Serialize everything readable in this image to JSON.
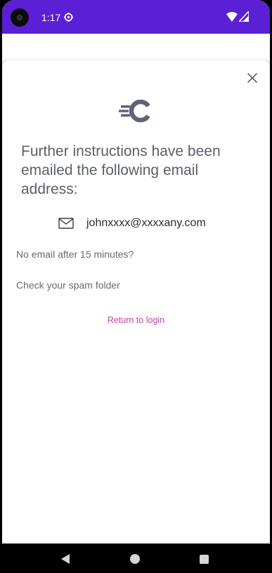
{
  "status_bar": {
    "time": "1:17",
    "background": "#5b1fd6"
  },
  "sheet": {
    "heading": "Further instructions have been emailed the following email address:",
    "email": "johnxxxx@xxxxany.com",
    "no_email_text": "No email after 15 minutes?",
    "spam_text": "Check your spam folder",
    "return_link": "Return to login",
    "accent_color": "#c0449c",
    "logo_color": "#5e6475"
  },
  "icons": {
    "close": "close-icon",
    "logo": "brand-logo-icon",
    "mail": "mail-icon",
    "gear": "gear-icon",
    "wifi": "wifi-icon",
    "signal": "signal-icon"
  }
}
